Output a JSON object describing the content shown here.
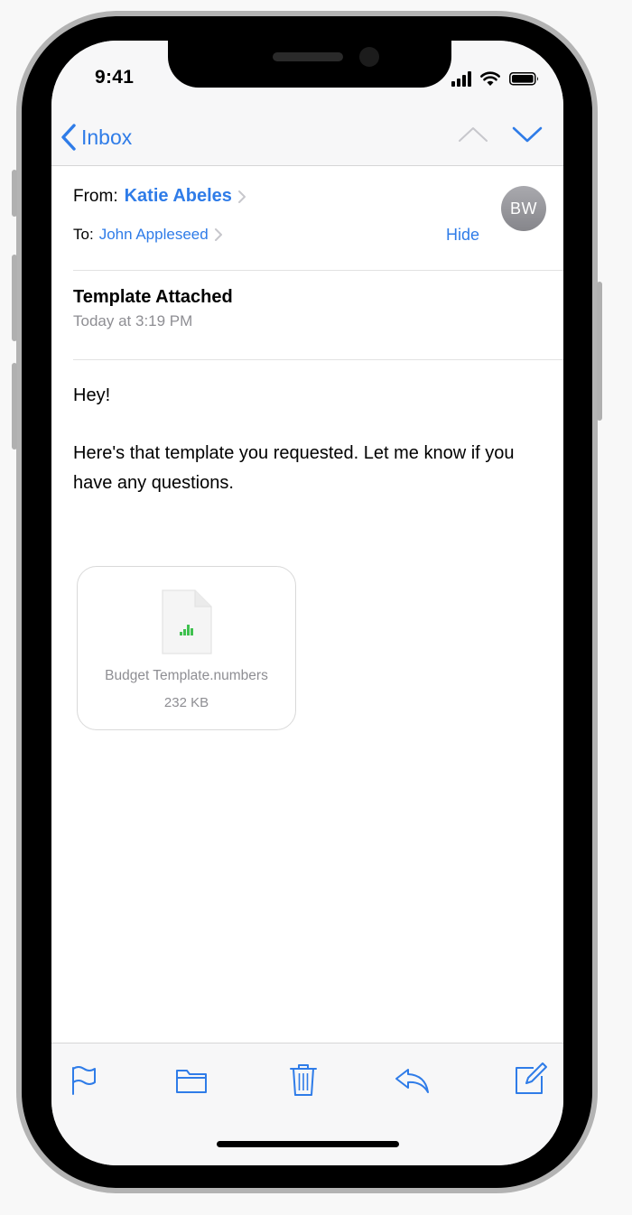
{
  "status_bar": {
    "time": "9:41"
  },
  "nav": {
    "back_label": "Inbox"
  },
  "header": {
    "from_label": "From:",
    "from_name": "Katie Abeles",
    "to_label": "To:",
    "to_name": "John Appleseed",
    "hide_label": "Hide",
    "avatar_initials": "BW"
  },
  "message": {
    "subject": "Template Attached",
    "date": "Today at 3:19 PM",
    "greeting": "Hey!",
    "body": "Here's that template you requested. Let me know if you have any questions."
  },
  "attachment": {
    "file_name": "Budget Template.numbers",
    "file_size": "232 KB",
    "icon": "numbers-file-icon"
  },
  "toolbar": {
    "items": [
      "flag-icon",
      "folder-icon",
      "trash-icon",
      "reply-icon",
      "compose-icon"
    ]
  },
  "colors": {
    "accent": "#2f7ce8",
    "secondary_text": "#8e8e93",
    "numbers_green": "#3fc14f"
  }
}
